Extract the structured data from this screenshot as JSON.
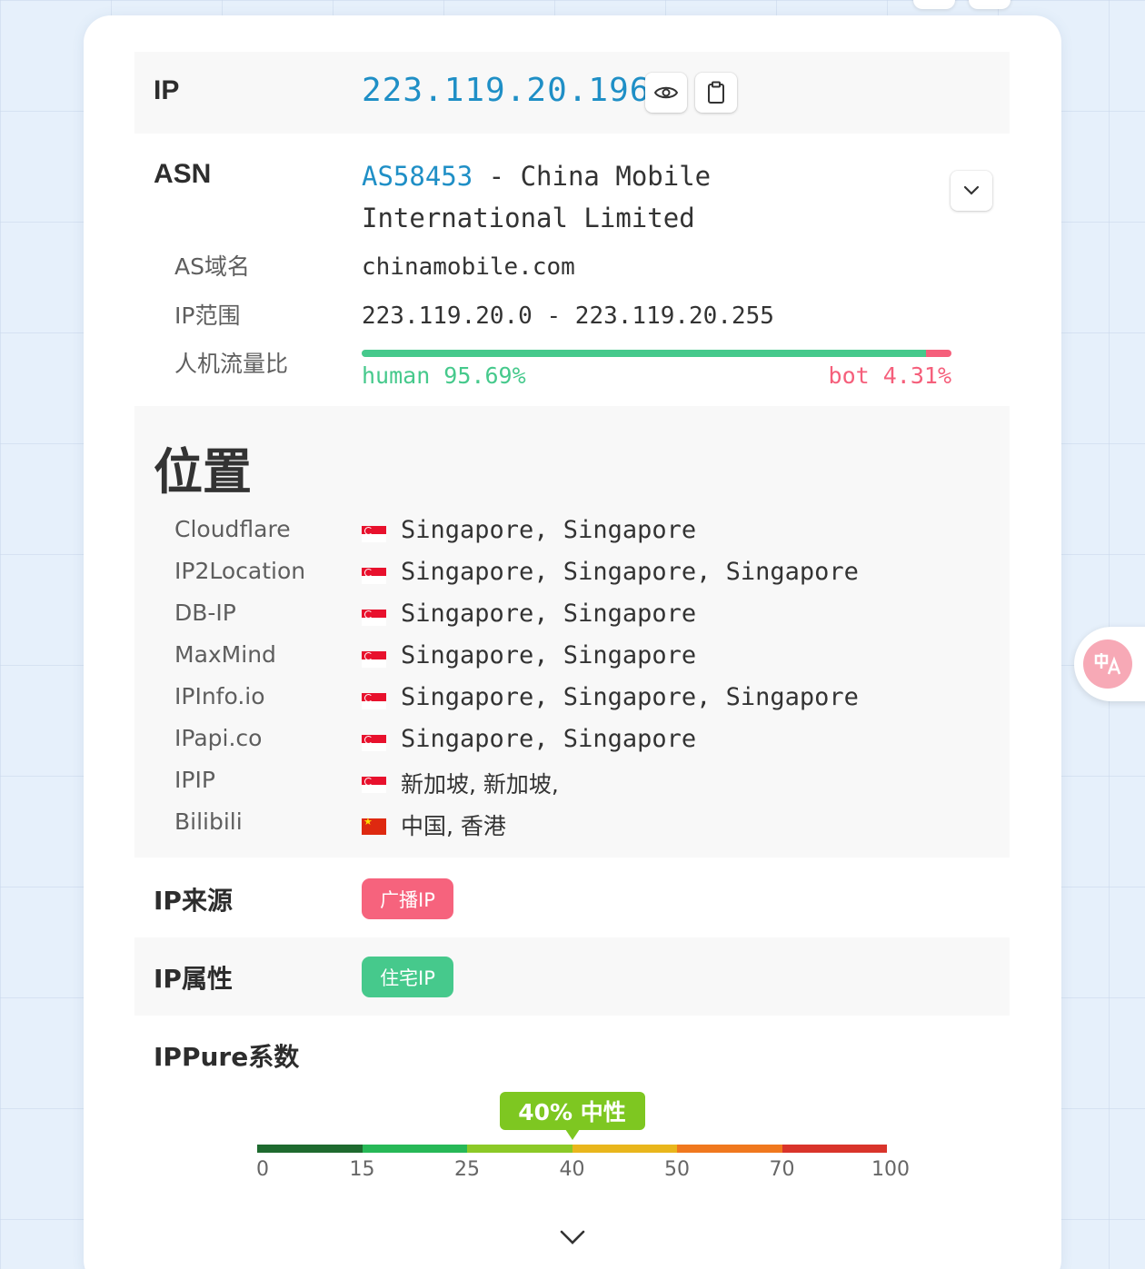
{
  "ip": {
    "label": "IP",
    "value": "223.119.20.196"
  },
  "asn": {
    "label": "ASN",
    "as_number": "AS58453",
    "name_line1": " - China Mobile",
    "name_line2": "International Limited",
    "rows": [
      {
        "label": "AS域名",
        "value": "chinamobile.com"
      },
      {
        "label": "IP范围",
        "value": "223.119.20.0 - 223.119.20.255"
      }
    ],
    "traffic": {
      "label": "人机流量比",
      "human_text": "human 95.69%",
      "bot_text": "bot 4.31%",
      "human_fraction": 0.9569,
      "human_color": "#46c98c",
      "bot_color": "#f55f7b"
    }
  },
  "location": {
    "heading": "位置",
    "sources": [
      {
        "source": "Cloudflare",
        "flag": "sg-flag",
        "place": "Singapore, Singapore"
      },
      {
        "source": "IP2Location",
        "flag": "sg-flag",
        "place": "Singapore, Singapore, Singapore"
      },
      {
        "source": "DB-IP",
        "flag": "sg-flag",
        "place": "Singapore, Singapore"
      },
      {
        "source": "MaxMind",
        "flag": "sg-flag",
        "place": "Singapore, Singapore"
      },
      {
        "source": "IPInfo.io",
        "flag": "sg-flag",
        "place": "Singapore, Singapore, Singapore"
      },
      {
        "source": "IPapi.co",
        "flag": "sg-flag",
        "place": "Singapore, Singapore"
      },
      {
        "source": "IPIP",
        "flag": "sg-flag",
        "place": "新加坡, 新加坡,"
      },
      {
        "source": "Bilibili",
        "flag": "cn-flag",
        "place": "中国, 香港"
      }
    ]
  },
  "ip_source": {
    "label": "IP来源",
    "badge": "广播IP",
    "badge_color": "#f6637d"
  },
  "ip_attr": {
    "label": "IP属性",
    "badge": "住宅IP",
    "badge_color": "#46c98c"
  },
  "ippure": {
    "label": "IPPure系数",
    "marker_text": "40% 中性",
    "value_percent": 40,
    "marker_color": "#7ec721",
    "ticks": [
      "0",
      "15",
      "25",
      "40",
      "50",
      "70",
      "100"
    ],
    "segment_colors": [
      "#1e6a2f",
      "#27b857",
      "#8cc927",
      "#e9b61c",
      "#f0781e",
      "#d9342b"
    ]
  },
  "icons": {
    "reveal": "eye-icon",
    "copy": "clipboard-icon",
    "expand_asn": "chevron-down-icon",
    "more": "chevron-down-icon",
    "translate": "translate-icon"
  }
}
